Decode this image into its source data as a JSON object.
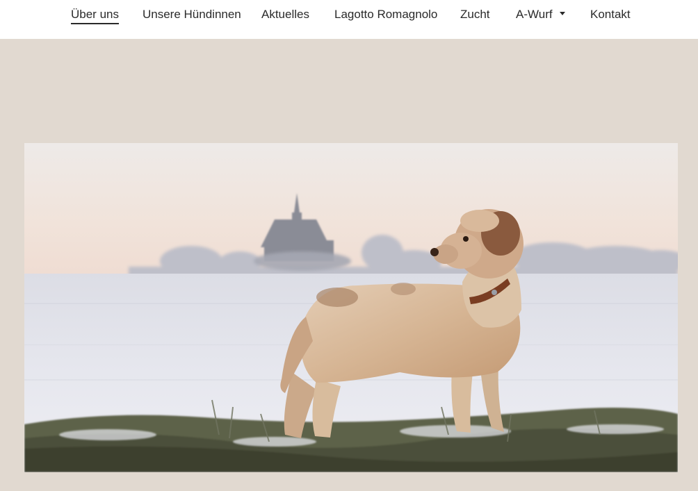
{
  "nav": {
    "items": [
      {
        "label": "Über uns",
        "active": true
      },
      {
        "label": "Unsere Hündinnen",
        "active": false
      },
      {
        "label": "Aktuelles",
        "active": false
      },
      {
        "label": "Lagotto Romagnolo",
        "active": false
      },
      {
        "label": "Zucht",
        "active": false
      },
      {
        "label": "A-Wurf",
        "active": false,
        "has_dropdown": true
      },
      {
        "label": "Kontakt",
        "active": false
      }
    ]
  },
  "hero": {
    "image": "lagotto-romagnolo-dog-in-snowy-field-photo"
  },
  "colors": {
    "page_background": "#e1d9d0",
    "header_background": "#ffffff",
    "nav_text": "#2a2a2a"
  }
}
